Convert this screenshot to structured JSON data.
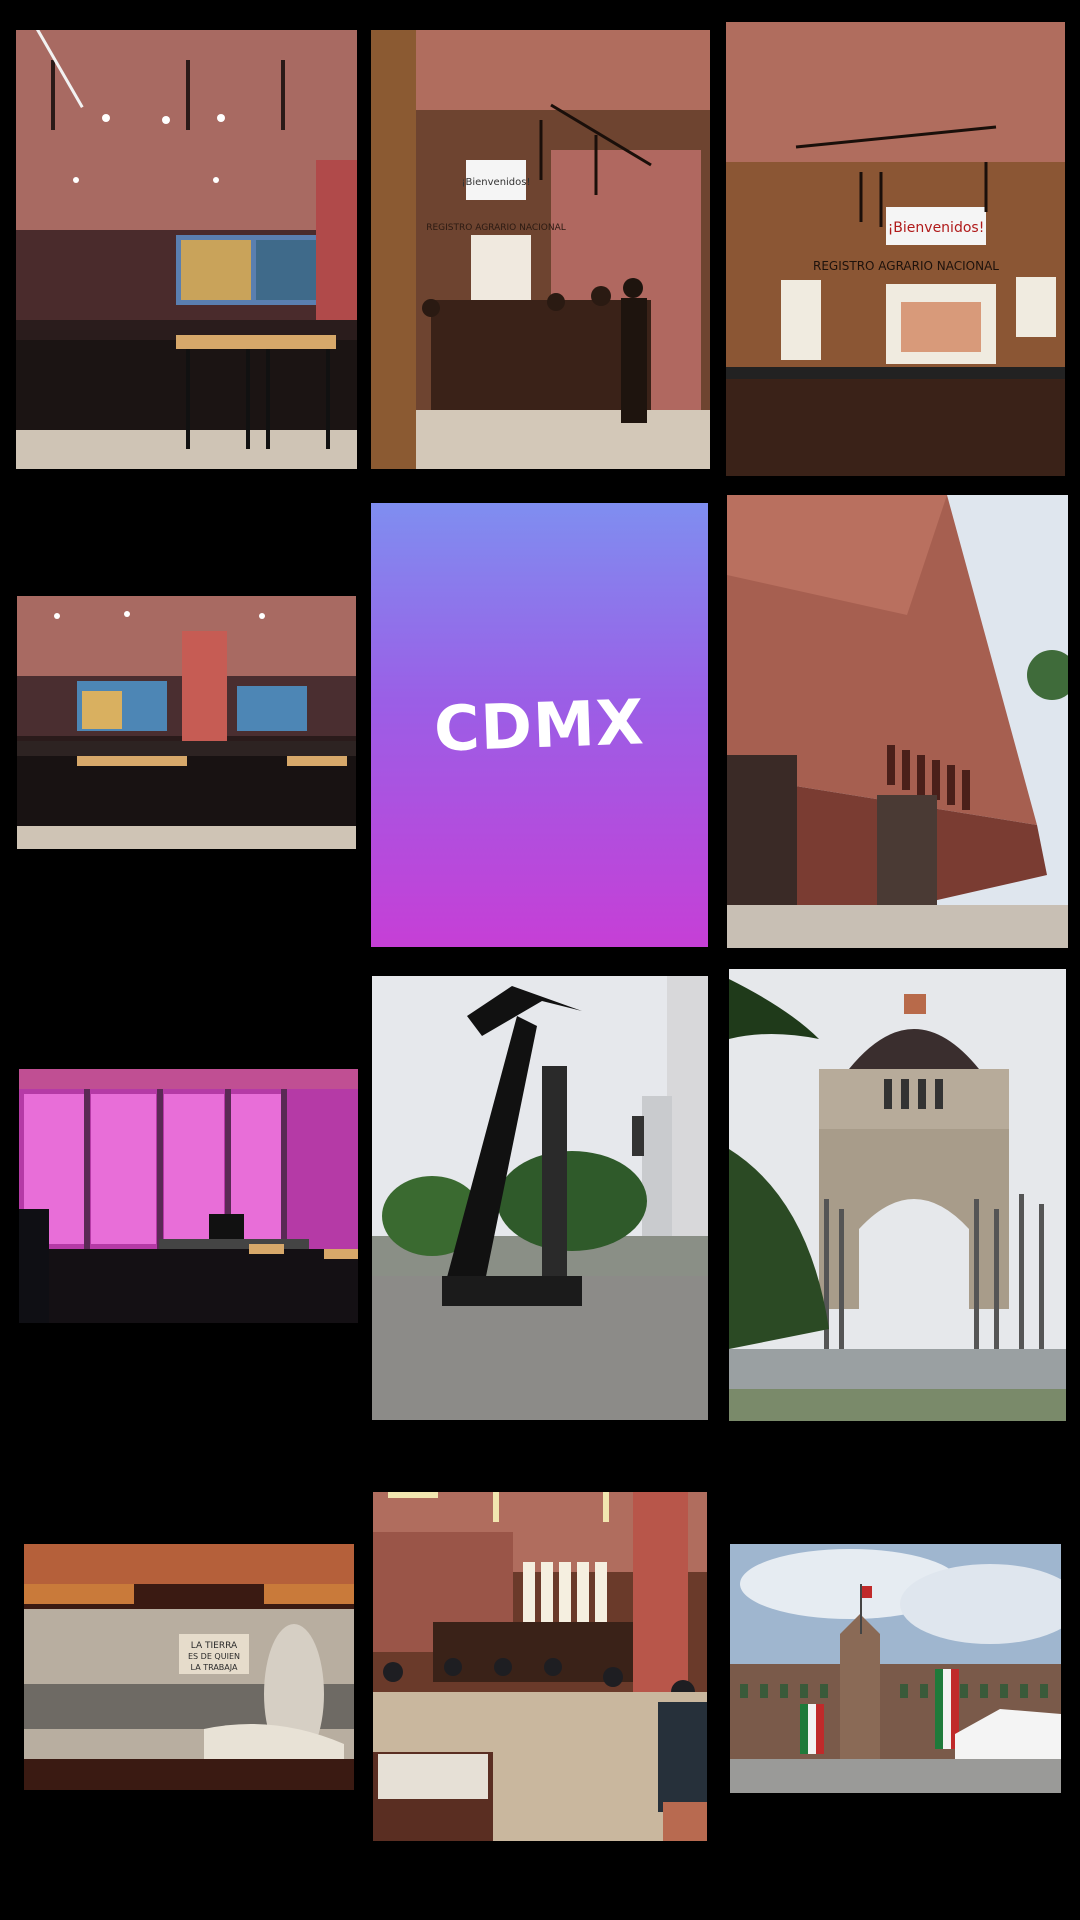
{
  "collage": {
    "center_label": "CDMX",
    "photos": [
      {
        "id": 1,
        "subject": "office-hall-stools"
      },
      {
        "id": 2,
        "subject": "reception-desk"
      },
      {
        "id": 3,
        "subject": "reception-wall"
      },
      {
        "id": 4,
        "subject": "office-hall-wide"
      },
      {
        "id": 6,
        "subject": "building-facade"
      },
      {
        "id": 7,
        "subject": "magenta-office"
      },
      {
        "id": 8,
        "subject": "black-sculpture"
      },
      {
        "id": 9,
        "subject": "revolution-monument"
      },
      {
        "id": 10,
        "subject": "mural"
      },
      {
        "id": 11,
        "subject": "waiting-hall"
      },
      {
        "id": 12,
        "subject": "national-palace"
      }
    ],
    "signs": {
      "welcome": "¡Bienvenidos!",
      "registry": "REGISTRO AGRARIO NACIONAL",
      "mural_banner_1": "LA TIERRA",
      "mural_banner_2": "ES DE QUIEN",
      "mural_banner_3": "LA TRABAJA"
    },
    "colors": {
      "background": "#000000",
      "gradient_top": "#7f8ef0",
      "gradient_bottom": "#c63fd6",
      "terracotta": "#b5655a"
    }
  }
}
